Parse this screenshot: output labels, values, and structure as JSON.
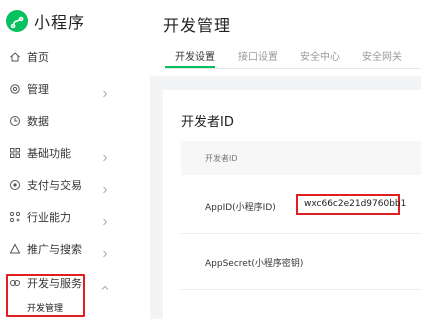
{
  "brand": {
    "name": "小程序",
    "icon": "mini-program-logo-icon",
    "color": "#07c160"
  },
  "sidebar": {
    "items": [
      {
        "label": "首页",
        "icon": "home-icon",
        "has_chevron": false
      },
      {
        "label": "管理",
        "icon": "settings-icon",
        "has_chevron": true
      },
      {
        "label": "数据",
        "icon": "chart-icon",
        "has_chevron": false
      },
      {
        "label": "基础功能",
        "icon": "grid-icon",
        "has_chevron": true
      },
      {
        "label": "支付与交易",
        "icon": "pay-icon",
        "has_chevron": true
      },
      {
        "label": "行业能力",
        "icon": "industry-icon",
        "has_chevron": true
      },
      {
        "label": "推广与搜索",
        "icon": "promote-icon",
        "has_chevron": true
      },
      {
        "label": "开发与服务",
        "icon": "dev-icon",
        "has_chevron": true,
        "expanded": true
      }
    ],
    "sub_item": "开发管理"
  },
  "page": {
    "title": "开发管理"
  },
  "tabs": [
    {
      "label": "开发设置",
      "active": true
    },
    {
      "label": "接口设置",
      "active": false
    },
    {
      "label": "安全中心",
      "active": false
    },
    {
      "label": "安全网关",
      "active": false
    }
  ],
  "developer_id": {
    "title": "开发者ID",
    "header": "开发者ID",
    "rows": [
      {
        "label": "AppID(小程序ID)",
        "value": "wxc66c2e21d9760bb1"
      },
      {
        "label": "AppSecret(小程序密钥)",
        "value": ""
      }
    ]
  },
  "colors": {
    "accent": "#07c160",
    "highlight": "#e02020"
  }
}
